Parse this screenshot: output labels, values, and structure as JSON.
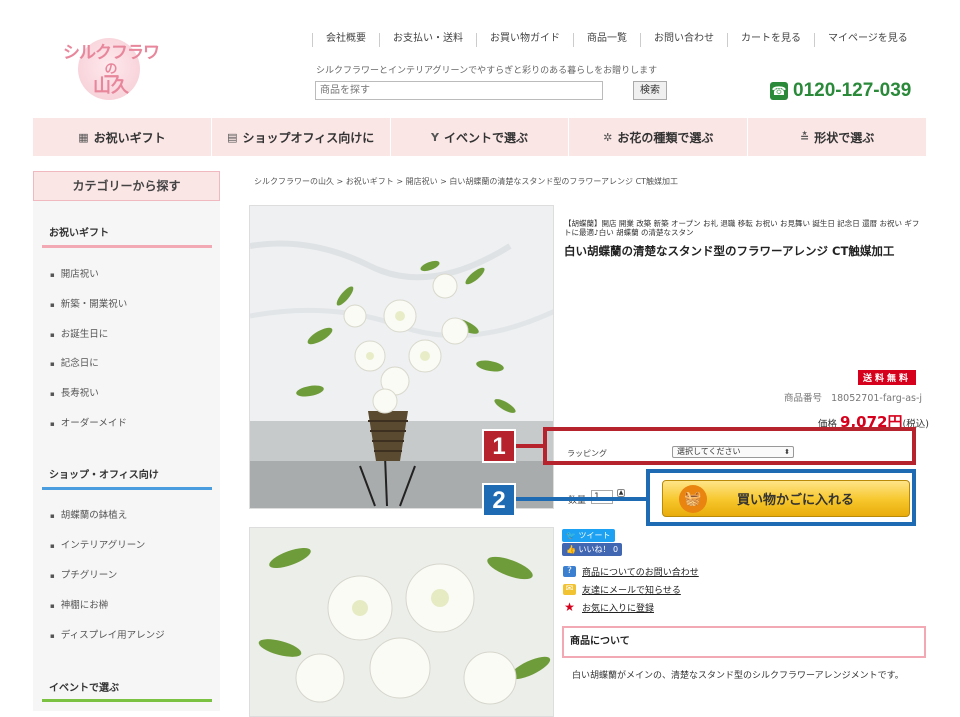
{
  "logo": {
    "line1": "シルクフラワー",
    "line2": "の",
    "line3": "山久"
  },
  "topnav": [
    "会社概要",
    "お支払い・送料",
    "お買い物ガイド",
    "商品一覧",
    "お問い合わせ",
    "カートを見る",
    "マイページを見る"
  ],
  "tagline": "シルクフラワーとインテリアグリーンでやすらぎと彩りのある暮らしをお贈りします",
  "search": {
    "placeholder": "商品を探す",
    "button": "検索"
  },
  "phone": "0120-127-039",
  "mainmenu": [
    {
      "label": "お祝いギフト",
      "icon": "gift-icon"
    },
    {
      "label": "ショップオフィス向けに",
      "icon": "building-icon"
    },
    {
      "label": "イベントで選ぶ",
      "icon": "glass-icon"
    },
    {
      "label": "お花の種類で選ぶ",
      "icon": "flower-icon"
    },
    {
      "label": "形状で選ぶ",
      "icon": "shape-icon"
    }
  ],
  "breadcrumb": "シルクフラワーの山久 > お祝いギフト > 開店祝い > 白い胡蝶蘭の清楚なスタンド型のフラワーアレンジ CT触媒加工",
  "sidebar": {
    "heading": "カテゴリーから探す",
    "sections": [
      {
        "title": "お祝いギフト",
        "color": "#f2a9b4",
        "items": [
          "開店祝い",
          "新築・開業祝い",
          "お誕生日に",
          "記念日に",
          "長寿祝い",
          "オーダーメイド"
        ]
      },
      {
        "title": "ショップ・オフィス向け",
        "color": "#4a9ee0",
        "items": [
          "胡蝶蘭の鉢植え",
          "インテリアグリーン",
          "プチグリーン",
          "神棚にお榊",
          "ディスプレイ用アレンジ"
        ]
      },
      {
        "title": "イベントで選ぶ",
        "color": "#7cc242",
        "items": []
      }
    ]
  },
  "product": {
    "subtitle": "【胡蝶蘭】開店 開業 改築 新築 オープン お礼 退職 移転 お祝い お見舞い 誕生日 記念日 還暦 お祝い ギフトに最適♪白い 胡蝶蘭 の清楚なスタン",
    "title": "白い胡蝶蘭の清楚なスタンド型のフラワーアレンジ CT触媒加工",
    "free_shipping": "送料無料",
    "sku_label": "商品番号",
    "sku": "18052701-farg-as-j",
    "price_label": "価格",
    "price": "9,072円",
    "tax": "(税込)",
    "wrapping_label": "ラッピング",
    "wrapping_value": "選択してください",
    "qty_label": "数量",
    "qty": "1",
    "cart_button": "買い物かごに入れる"
  },
  "annotations": {
    "one": "1",
    "two": "2"
  },
  "social": {
    "tweet": "ツイート",
    "like": "いいね！ 0"
  },
  "links": [
    {
      "text": "商品についてのお問い合わせ",
      "icon": "question-icon",
      "color": "#3b7fd1"
    },
    {
      "text": "友達にメールで知らせる",
      "icon": "mail-icon",
      "color": "#f1c232"
    },
    {
      "text": "お気に入りに登録",
      "icon": "star-icon",
      "color": "#d6001c"
    }
  ],
  "about": {
    "heading": "商品について",
    "text": "白い胡蝶蘭がメインの、清楚なスタンド型のシルクフラワーアレンジメントです。"
  }
}
